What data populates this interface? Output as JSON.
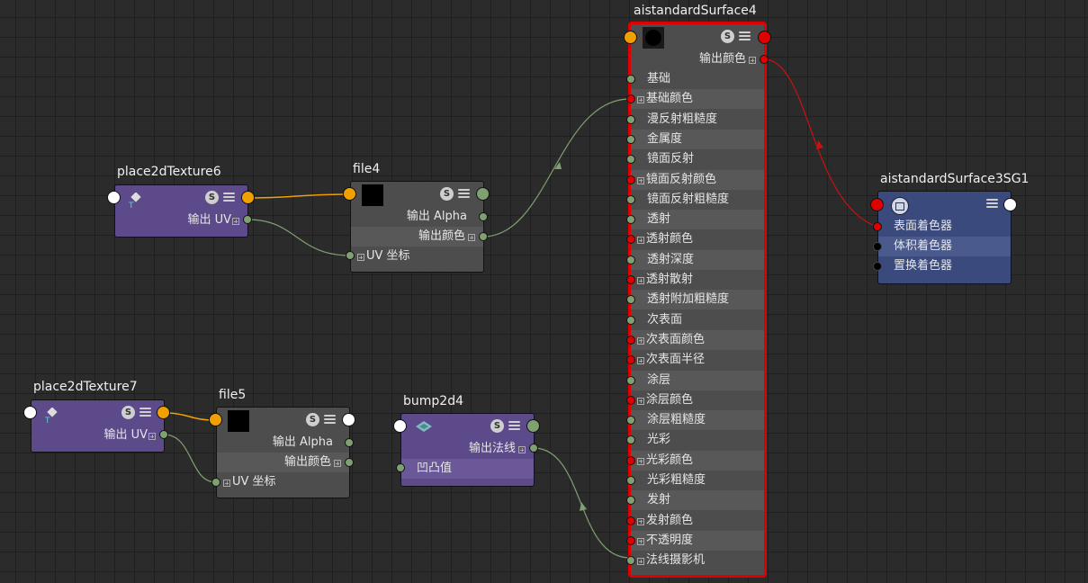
{
  "nodes": {
    "place2dTexture6": {
      "title": "place2dTexture6",
      "out_uv": "输出 UV"
    },
    "place2dTexture7": {
      "title": "place2dTexture7",
      "out_uv": "输出 UV"
    },
    "file4": {
      "title": "file4",
      "out_alpha": "输出 Alpha",
      "out_color": "输出颜色",
      "uv_coord": "UV 坐标"
    },
    "file5": {
      "title": "file5",
      "out_alpha": "输出 Alpha",
      "out_color": "输出颜色",
      "uv_coord": "UV 坐标"
    },
    "bump2d4": {
      "title": "bump2d4",
      "out_normal": "输出法线",
      "bump_value": "凹凸值"
    },
    "aistandardSurface4": {
      "title": "aistandardSurface4",
      "out_color": "输出颜色",
      "attributes": [
        "基础",
        "基础颜色",
        "漫反射粗糙度",
        "金属度",
        "镜面反射",
        "镜面反射颜色",
        "镜面反射粗糙度",
        "透射",
        "透射颜色",
        "透射深度",
        "透射散射",
        "透射附加粗糙度",
        "次表面",
        "次表面颜色",
        "次表面半径",
        "涂层",
        "涂层颜色",
        "涂层粗糙度",
        "光彩",
        "光彩颜色",
        "光彩粗糙度",
        "发射",
        "发射颜色",
        "不透明度",
        "法线摄影机"
      ]
    },
    "aistandardSurface3SG1": {
      "title": "aistandardSurface3SG1",
      "attributes": [
        "表面着色器",
        "体积着色器",
        "置换着色器"
      ]
    }
  },
  "icons": {
    "s": "S",
    "menu": "menu-icon",
    "place2d": "place2d-texture-icon",
    "bump": "bump2d-icon",
    "sg": "shading-group-icon"
  },
  "colors": {
    "grid": "#2b2b2b",
    "purple_node": "#5c4a8a",
    "gray_node": "#4d4d4d",
    "blue_node": "#3a4a7c",
    "selected_border": "#e00000",
    "wire_green": "#7fa070",
    "wire_orange": "#f0a000",
    "wire_red": "#cc1010"
  }
}
